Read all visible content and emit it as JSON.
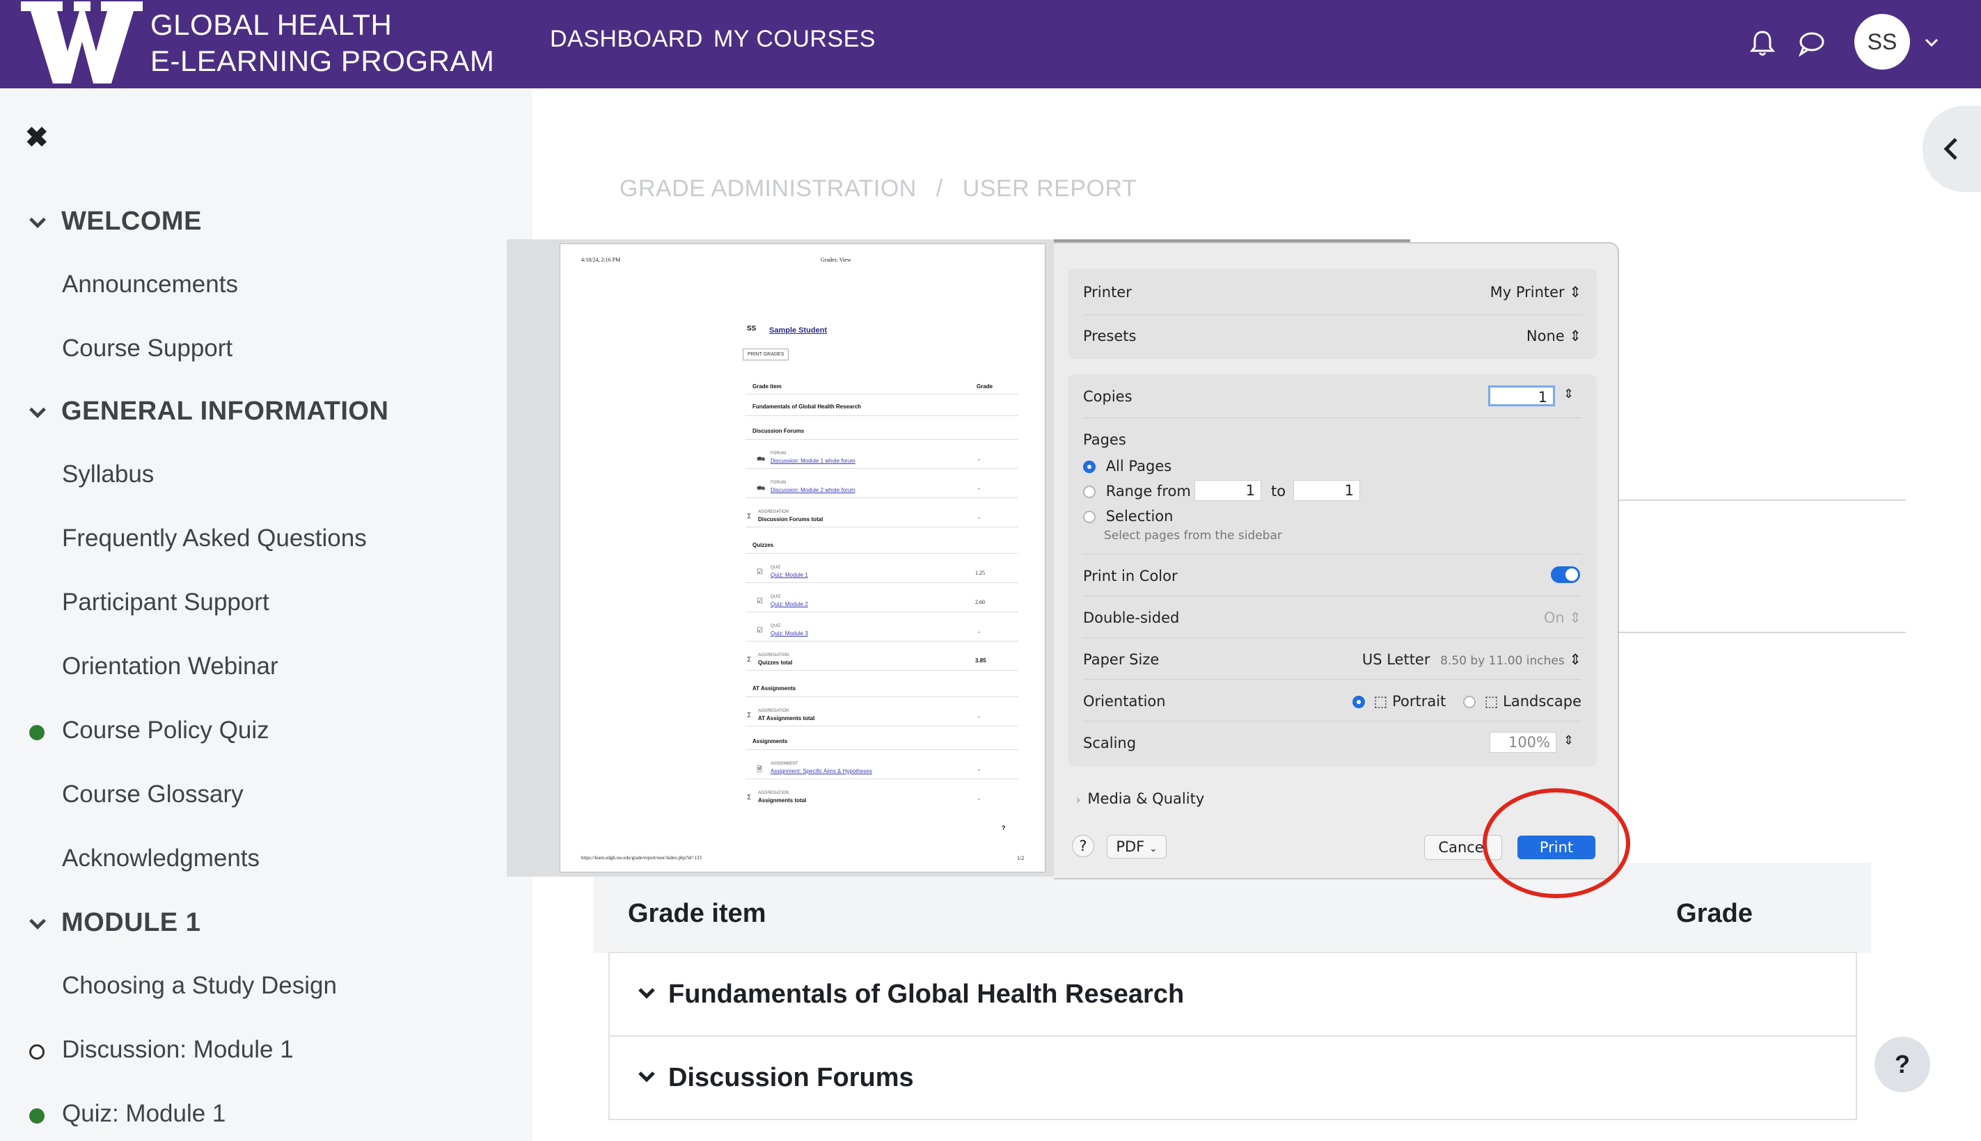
{
  "header": {
    "logo_letter": "W",
    "logo_line1": "GLOBAL HEALTH",
    "logo_line2": "E-LEARNING PROGRAM",
    "nav": [
      "DASHBOARD",
      "MY COURSES"
    ],
    "avatar_initials": "SS",
    "brand_color": "#4b2e83"
  },
  "sidebar": {
    "sections": [
      {
        "title": "WELCOME",
        "items": [
          {
            "label": "Announcements",
            "status": "none"
          },
          {
            "label": "Course Support",
            "status": "none"
          }
        ]
      },
      {
        "title": "GENERAL INFORMATION",
        "items": [
          {
            "label": "Syllabus",
            "status": "none"
          },
          {
            "label": "Frequently Asked Questions",
            "status": "none"
          },
          {
            "label": "Participant Support",
            "status": "none"
          },
          {
            "label": "Orientation Webinar",
            "status": "none"
          },
          {
            "label": "Course Policy Quiz",
            "status": "complete"
          },
          {
            "label": "Course Glossary",
            "status": "none"
          },
          {
            "label": "Acknowledgments",
            "status": "none"
          }
        ]
      },
      {
        "title": "MODULE 1",
        "items": [
          {
            "label": "Choosing a Study Design",
            "status": "none"
          },
          {
            "label": "Discussion: Module 1",
            "status": "incomplete"
          },
          {
            "label": "Quiz: Module 1",
            "status": "complete"
          }
        ]
      }
    ]
  },
  "breadcrumb": [
    "GRADE ADMINISTRATION",
    "/",
    "USER REPORT"
  ],
  "grade_table": {
    "col_item": "Grade item",
    "col_grade": "Grade",
    "rows": [
      "Fundamentals of Global Health Research",
      "Discussion Forums"
    ]
  },
  "preview": {
    "header_left": "4/18/24, 2:16 PM",
    "header_center": "Grades: View",
    "user_initials": "SS",
    "user_name": "Sample Student",
    "print_btn": "PRINT GRADES",
    "col_item": "Grade item",
    "col_grade": "Grade",
    "course": "Fundamentals of Global Health Research",
    "cat_forums": "Discussion Forums",
    "cap_forum": "FORUM",
    "forum1": "Discussion: Module 1 whole forum",
    "forum2": "Discussion: Module 2 whole forum",
    "cap_agg": "AGGREGATION",
    "forums_total": "Discussion Forums total",
    "cat_quizzes": "Quizzes",
    "cap_quiz": "QUIZ",
    "quiz1": "Quiz: Module 1",
    "quiz2": "Quiz: Module 2",
    "quiz3": "Quiz: Module 3",
    "quizzes_total": "Quizzes total",
    "cat_at": "AT Assignments",
    "at_total": "AT Assignments total",
    "cat_assign": "Assignments",
    "cap_assignment": "ASSIGNMENT",
    "assign1": "Assignment: Specific Aims & Hypotheses",
    "assign_total": "Assignments total",
    "dash": "-",
    "q1_grade": "1.25",
    "q2_grade": "2.60",
    "qt_grade": "3.85",
    "help_mark": "?",
    "footer_url": "https://learn.edgh.uw.edu/grade/report/user/index.php?id=133",
    "footer_page": "1/2"
  },
  "print_dialog": {
    "printer_label": "Printer",
    "printer_value": "My Printer",
    "presets_label": "Presets",
    "presets_value": "None",
    "copies_label": "Copies",
    "copies_value": "1",
    "pages_label": "Pages",
    "all_pages": "All Pages",
    "range_from": "Range from",
    "range_start": "1",
    "range_to": "to",
    "range_end": "1",
    "selection": "Selection",
    "selection_hint": "Select pages from the sidebar",
    "color_label": "Print in Color",
    "double_label": "Double-sided",
    "double_value": "On",
    "paper_label": "Paper Size",
    "paper_value": "US Letter",
    "paper_dims": "8.50 by 11.00 inches",
    "orientation_label": "Orientation",
    "portrait": "Portrait",
    "landscape": "Landscape",
    "scaling_label": "Scaling",
    "scaling_value": "100%",
    "media_label": "Media & Quality",
    "help": "?",
    "pdf": "PDF",
    "cancel": "Cancel",
    "print": "Print",
    "accent": "#1f6de0",
    "highlight": "#e0261a"
  },
  "help_fab": "?"
}
